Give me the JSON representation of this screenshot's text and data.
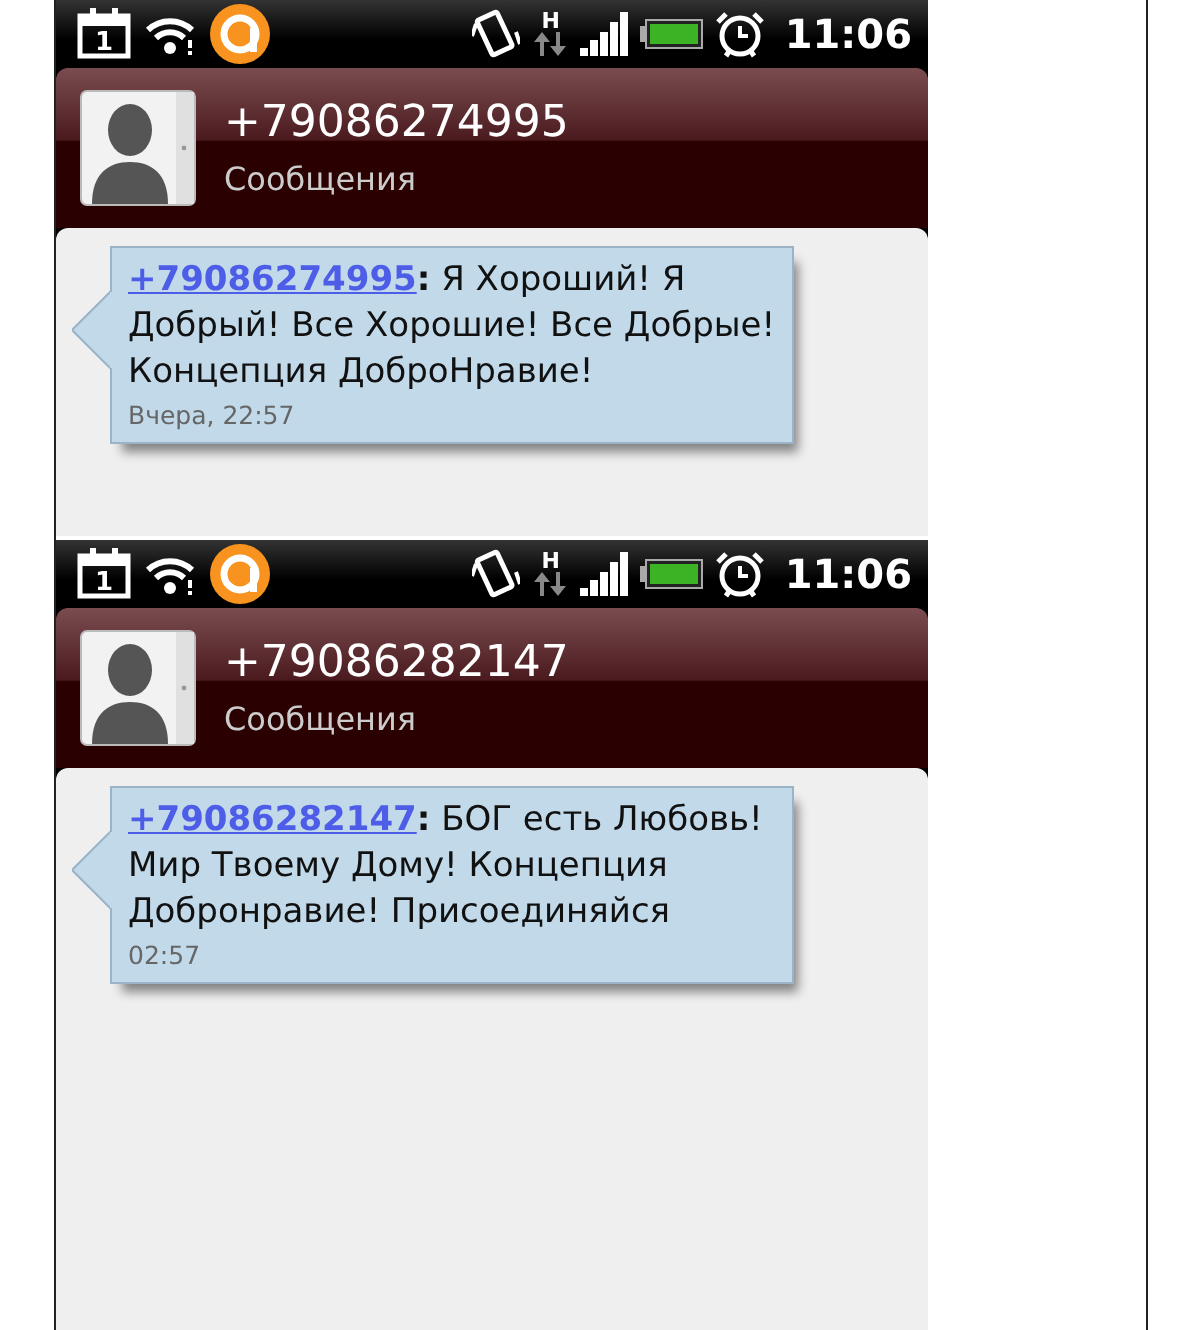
{
  "screens": [
    {
      "status_bar": {
        "calendar_day": "1",
        "network_type": "H",
        "time": "11:06"
      },
      "header": {
        "title": "+79086274995",
        "subtitle": "Сообщения"
      },
      "message": {
        "sender": "+79086274995",
        "text": "**:** Я Хороший! Я Добрый! Все Хорошие! Все Добрые! Концепция ДоброНравие!",
        "time": "Вчера, 22:57"
      }
    },
    {
      "status_bar": {
        "calendar_day": "1",
        "network_type": "H",
        "time": "11:06"
      },
      "header": {
        "title": "+79086282147",
        "subtitle": "Сообщения"
      },
      "message": {
        "sender": "+79086282147",
        "text": "**:** БОГ есть Любовь!Мир Твоему Дому! Концепция Добронравие! Присоединяйся",
        "time": "02:57"
      }
    }
  ]
}
